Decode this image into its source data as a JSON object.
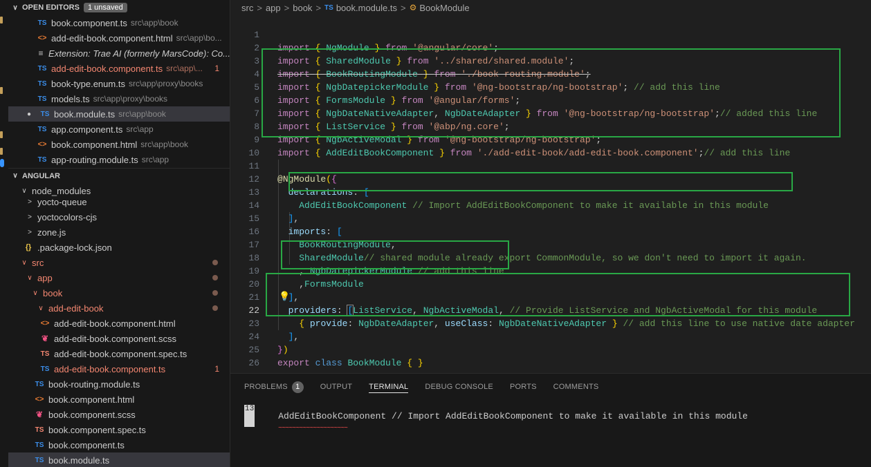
{
  "sidebar": {
    "open_editors": {
      "title": "OPEN EDITORS",
      "badge": "1 unsaved",
      "items": [
        {
          "icon": "TS",
          "name": "book.component.ts",
          "path": "src\\app\\book"
        },
        {
          "icon": "<>",
          "name": "add-edit-book.component.html",
          "path": "src\\app\\bo..."
        },
        {
          "icon": "≡",
          "name": "Extension: Trae AI (formerly MarsCode): Co...",
          "path": ""
        },
        {
          "icon": "TS",
          "name": "add-edit-book.component.ts",
          "path": "src\\app\\...",
          "count": "1"
        },
        {
          "icon": "TS",
          "name": "book-type.enum.ts",
          "path": "src\\app\\proxy\\books"
        },
        {
          "icon": "TS",
          "name": "models.ts",
          "path": "src\\app\\proxy\\books"
        },
        {
          "icon": "TS",
          "name": "book.module.ts",
          "path": "src\\app\\book"
        },
        {
          "icon": "TS",
          "name": "app.component.ts",
          "path": "src\\app"
        },
        {
          "icon": "<>",
          "name": "book.component.html",
          "path": "src\\app\\book"
        },
        {
          "icon": "TS",
          "name": "app-routing.module.ts",
          "path": "src\\app"
        }
      ]
    },
    "explorer": {
      "title": "ANGULAR",
      "items": [
        {
          "chev": "∨",
          "icon": "",
          "name": "node_modules"
        },
        {
          "chev": ">",
          "icon": "",
          "name": "yocto-queue"
        },
        {
          "chev": ">",
          "icon": "",
          "name": "yoctocolors-cjs"
        },
        {
          "chev": ">",
          "icon": "",
          "name": "zone.js"
        },
        {
          "chev": "",
          "icon": "{}",
          "name": ".package-lock.json"
        },
        {
          "chev": "∨",
          "icon": "",
          "name": "src"
        },
        {
          "chev": "∨",
          "icon": "",
          "name": "app"
        },
        {
          "chev": "∨",
          "icon": "",
          "name": "book"
        },
        {
          "chev": "∨",
          "icon": "",
          "name": "add-edit-book"
        },
        {
          "chev": "",
          "icon": "<>",
          "name": "add-edit-book.component.html"
        },
        {
          "chev": "",
          "icon": "❦",
          "name": "add-edit-book.component.scss"
        },
        {
          "chev": "",
          "icon": "TS",
          "name": "add-edit-book.component.spec.ts"
        },
        {
          "chev": "",
          "icon": "TS",
          "name": "add-edit-book.component.ts",
          "count": "1"
        },
        {
          "chev": "",
          "icon": "TS",
          "name": "book-routing.module.ts"
        },
        {
          "chev": "",
          "icon": "<>",
          "name": "book.component.html"
        },
        {
          "chev": "",
          "icon": "❦",
          "name": "book.component.scss"
        },
        {
          "chev": "",
          "icon": "TS",
          "name": "book.component.spec.ts"
        },
        {
          "chev": "",
          "icon": "TS",
          "name": "book.component.ts"
        },
        {
          "chev": "",
          "icon": "TS",
          "name": "book.module.ts"
        }
      ]
    }
  },
  "breadcrumb": {
    "parts": [
      "src",
      "app",
      "book"
    ],
    "file": "book.module.ts",
    "symbol": "BookModule",
    "separator": ">"
  },
  "editor": {
    "active_line": "22",
    "lines": [
      "1",
      "2",
      "3",
      "4",
      "5",
      "6",
      "7",
      "8",
      "9",
      "10",
      "11",
      "12",
      "13",
      "14",
      "15",
      "16",
      "17",
      "18",
      "19",
      "20",
      "21",
      "22",
      "23",
      "24",
      "25",
      "26"
    ],
    "code": {
      "l1": [
        "import",
        "{",
        "NgModule",
        "}",
        "from",
        "'@angular/core'",
        ";"
      ],
      "l2": [
        "import",
        "{",
        "SharedModule",
        "}",
        "from",
        "'../shared/shared.module'",
        ";"
      ],
      "l3": [
        "import",
        "{",
        "BookRoutingModule",
        "}",
        "from",
        "'./book-routing.module'",
        ";"
      ],
      "l4": [
        "import",
        "{",
        "NgbDatepickerModule",
        "}",
        "from",
        "'@ng-bootstrap/ng-bootstrap'",
        ";",
        "// add this line"
      ],
      "l5": [
        "import",
        "{",
        "FormsModule",
        "}",
        "from",
        "'@angular/forms'",
        ";"
      ],
      "l6": [
        "import",
        "{",
        "NgbDateNativeAdapter",
        ",",
        "NgbDateAdapter",
        "}",
        "from",
        "'@ng-bootstrap/ng-bootstrap'",
        ";",
        "// added this line"
      ],
      "l7": [
        "import",
        "{",
        "ListService",
        "}",
        "from",
        "'@abp/ng.core'",
        ";"
      ],
      "l8": [
        "import",
        "{",
        "NgbActiveModal",
        "}",
        "from",
        "'@ng-bootstrap/ng-bootstrap'",
        ";"
      ],
      "l9": [
        "import",
        "{",
        "AddEditBookComponent",
        "}",
        "from",
        "'./add-edit-book/add-edit-book.component'",
        ";",
        "// add this line"
      ],
      "l11": [
        "@",
        "NgModule",
        "(",
        "{"
      ],
      "l12": [
        "declarations",
        ":",
        "["
      ],
      "l13": [
        "AddEditBookComponent",
        "// Import AddEditBookComponent to make it available in this module"
      ],
      "l14": [
        "]",
        ","
      ],
      "l15": [
        "imports",
        ":",
        "["
      ],
      "l16": [
        "BookRoutingModule",
        ","
      ],
      "l17": [
        "SharedModule",
        "// shared module already export CommonModule, so we don't need to import it again."
      ],
      "l18": [
        ",",
        "NgbDatepickerModule",
        "// add this line"
      ],
      "l19": [
        ",",
        "FormsModule"
      ],
      "l20": [
        "]",
        ","
      ],
      "l21": [
        "providers",
        ":",
        "[",
        "ListService",
        ",",
        "NgbActiveModal",
        ",",
        "// Provide ListService and NgbActiveModal for this module"
      ],
      "l22": [
        "{",
        "provide",
        ":",
        "NgbDateAdapter",
        ",",
        "useClass",
        ":",
        "NgbDateNativeAdapter",
        "}",
        "// add this line to use native date adapter"
      ],
      "l23": [
        "]",
        ","
      ],
      "l24": [
        "}",
        ")"
      ],
      "l25": [
        "export",
        "class",
        "BookModule",
        "{",
        "}"
      ]
    }
  },
  "panel": {
    "tabs": [
      "PROBLEMS",
      "OUTPUT",
      "TERMINAL",
      "DEBUG CONSOLE",
      "PORTS",
      "COMMENTS"
    ],
    "problems_count": "1",
    "active_tab": "TERMINAL",
    "terminal": {
      "line_number": "13",
      "text": "AddEditBookComponent // Import AddEditBookComponent to make it available in this module",
      "squiggle": "~~~~~~~~~~~~~~~~~~~~"
    }
  },
  "colors": {
    "highlight_box": "#29a845",
    "background": "#1f1f1f",
    "sidebar": "#181818",
    "error": "#f48771"
  }
}
